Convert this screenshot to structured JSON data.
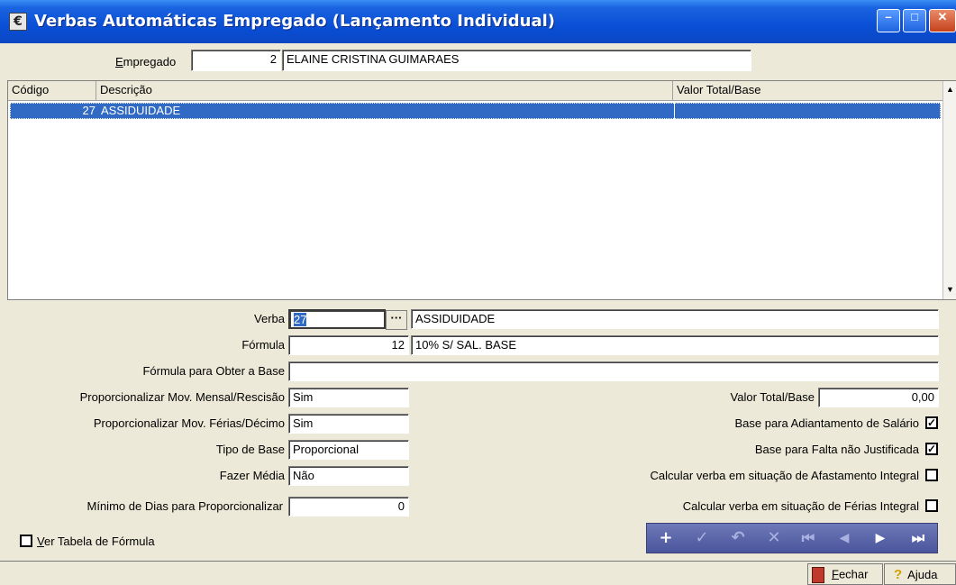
{
  "window": {
    "title": "Verbas Automáticas Empregado (Lançamento Individual)",
    "icon": "app-icon",
    "icon_glyph": "€",
    "controls": {
      "minimize": "–",
      "maximize": "□",
      "close": "✕"
    }
  },
  "empregado": {
    "label_pre": "",
    "label_u": "E",
    "label_post": "mpregado",
    "code": "2",
    "name": "ELAINE CRISTINA GUIMARAES"
  },
  "grid": {
    "columns": [
      "Código",
      "Descrição",
      "Valor Total/Base"
    ],
    "rows": [
      {
        "codigo": "27",
        "descricao": "ASSIDUIDADE",
        "valor": ""
      }
    ],
    "scroll_up": "▲",
    "scroll_down": "▼"
  },
  "form": {
    "verba": {
      "label": "Verba",
      "code": "27",
      "lookup": "···",
      "description": "ASSIDUIDADE"
    },
    "formula": {
      "label": "Fórmula",
      "code": "12",
      "description": "10% S/ SAL. BASE"
    },
    "formula_base": {
      "label": "Fórmula para Obter a Base",
      "value": ""
    },
    "prop_mensal": {
      "label": "Proporcionalizar Mov. Mensal/Rescisão",
      "value": "Sim"
    },
    "prop_ferias": {
      "label": "Proporcionalizar Mov. Férias/Décimo",
      "value": "Sim"
    },
    "tipo_base": {
      "label": "Tipo de Base",
      "value": "Proporcional"
    },
    "fazer_media": {
      "label": "Fazer Média",
      "value": "Não"
    },
    "minimo_dias": {
      "label": "Mínimo de Dias para Proporcionalizar",
      "value": "0"
    },
    "valor_total": {
      "label": "Valor Total/Base",
      "value": "0,00"
    },
    "checks": [
      {
        "label": "Base para Adiantamento de Salário",
        "checked": true,
        "mark": "✓"
      },
      {
        "label": "Base para Falta não Justificada",
        "checked": true,
        "mark": "✓"
      },
      {
        "label": "Calcular verba em situação de Afastamento Integral",
        "checked": false,
        "mark": ""
      },
      {
        "label": "Calcular verba em situação de Férias Integral",
        "checked": false,
        "mark": ""
      }
    ],
    "ver_tabela": {
      "label_u": "V",
      "label_post": "er Tabela de Fórmula",
      "checked": false
    }
  },
  "navigator": {
    "buttons": [
      {
        "name": "add",
        "glyph": "+",
        "enabled": true
      },
      {
        "name": "confirm",
        "glyph": "✓",
        "enabled": false
      },
      {
        "name": "undo",
        "glyph": "↶",
        "enabled": false
      },
      {
        "name": "delete",
        "glyph": "✕",
        "enabled": false
      },
      {
        "name": "first",
        "glyph": "⏮",
        "enabled": false
      },
      {
        "name": "prior",
        "glyph": "◀",
        "enabled": false
      },
      {
        "name": "next",
        "glyph": "▶",
        "enabled": true
      },
      {
        "name": "last",
        "glyph": "⏭",
        "enabled": true
      }
    ]
  },
  "status": {
    "fechar": {
      "label_u": "F",
      "label_post": "echar",
      "icon": "door-icon"
    },
    "ajuda": {
      "label": "Ajuda",
      "icon": "help-icon",
      "glyph": "?"
    }
  },
  "colors": {
    "titlebar": "#0a4fd6",
    "selection": "#316ac5",
    "navbar": "#4a559c",
    "window_bg": "#ece9d8"
  }
}
